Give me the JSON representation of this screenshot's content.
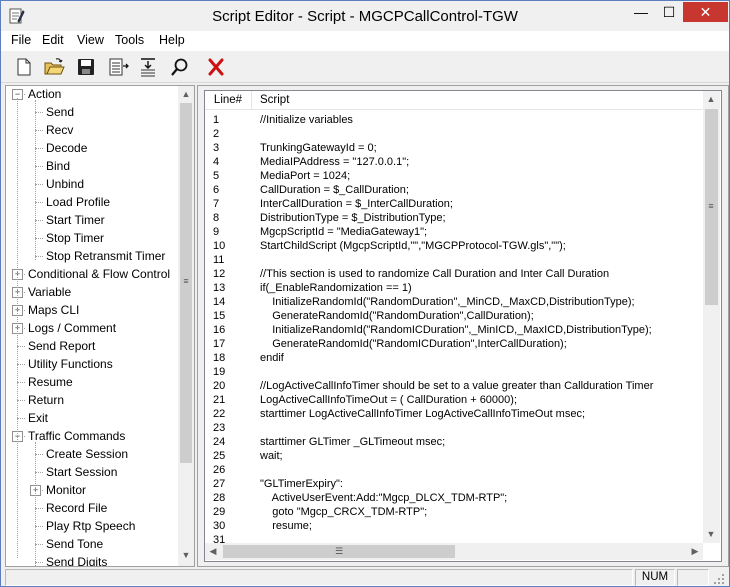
{
  "window": {
    "title": "Script Editor - Script - MGCPCallControl-TGW",
    "minimize": "—",
    "maximize": "☐",
    "close": "✕"
  },
  "menu": [
    "File",
    "Edit",
    "View",
    "Tools",
    "Help"
  ],
  "toolbar": {
    "icons": [
      "new-document-icon",
      "open-folder-icon",
      "save-icon",
      "insert-icon",
      "format-icon",
      "find-icon",
      "delete-icon"
    ]
  },
  "tree": {
    "items": [
      {
        "label": "Action",
        "expander": "-"
      },
      {
        "label": "Send"
      },
      {
        "label": "Recv"
      },
      {
        "label": "Decode"
      },
      {
        "label": "Bind"
      },
      {
        "label": "Unbind"
      },
      {
        "label": "Load Profile"
      },
      {
        "label": "Start Timer"
      },
      {
        "label": "Stop Timer"
      },
      {
        "label": "Stop Retransmit Timer"
      },
      {
        "label": "Conditional & Flow Control",
        "expander": "+"
      },
      {
        "label": "Variable",
        "expander": "+"
      },
      {
        "label": "Maps CLI",
        "expander": "+"
      },
      {
        "label": "Logs / Comment",
        "expander": "+"
      },
      {
        "label": "Send Report"
      },
      {
        "label": "Utility Functions"
      },
      {
        "label": "Resume"
      },
      {
        "label": "Return"
      },
      {
        "label": "Exit"
      },
      {
        "label": "Traffic Commands",
        "expander": "-"
      },
      {
        "label": "Create Session"
      },
      {
        "label": "Start Session"
      },
      {
        "label": "Monitor",
        "expander": "+"
      },
      {
        "label": "Record File"
      },
      {
        "label": "Play Rtp Speech"
      },
      {
        "label": "Send Tone"
      },
      {
        "label": "Send Digits"
      }
    ]
  },
  "script": {
    "header_line": "Line#",
    "header_script": "Script",
    "lines": [
      {
        "n": "1",
        "code": "//Initialize variables"
      },
      {
        "n": "2",
        "code": ""
      },
      {
        "n": "3",
        "code": "TrunkingGatewayId = 0;"
      },
      {
        "n": "4",
        "code": "MediaIPAddress = \"127.0.0.1\";"
      },
      {
        "n": "5",
        "code": "MediaPort = 1024;"
      },
      {
        "n": "6",
        "code": "CallDuration = $_CallDuration;"
      },
      {
        "n": "7",
        "code": "InterCallDuration = $_InterCallDuration;"
      },
      {
        "n": "8",
        "code": "DistributionType = $_DistributionType;"
      },
      {
        "n": "9",
        "code": "MgcpScriptId = \"MediaGateway1\";"
      },
      {
        "n": "10",
        "code": "StartChildScript (MgcpScriptId,\"\",\"MGCPProtocol-TGW.gls\",\"\");"
      },
      {
        "n": "11",
        "code": ""
      },
      {
        "n": "12",
        "code": "//This section is used to randomize Call Duration and Inter Call Duration"
      },
      {
        "n": "13",
        "code": "if(_EnableRandomization == 1)"
      },
      {
        "n": "14",
        "code": "    InitializeRandomId(\"RandomDuration\",_MinCD,_MaxCD,DistributionType);"
      },
      {
        "n": "15",
        "code": "    GenerateRandomId(\"RandomDuration\",CallDuration);"
      },
      {
        "n": "16",
        "code": "    InitializeRandomId(\"RandomICDuration\",_MinICD,_MaxICD,DistributionType);"
      },
      {
        "n": "17",
        "code": "    GenerateRandomId(\"RandomICDuration\",InterCallDuration);"
      },
      {
        "n": "18",
        "code": "endif"
      },
      {
        "n": "19",
        "code": ""
      },
      {
        "n": "20",
        "code": "//LogActiveCallInfoTimer should be set to a value greater than Callduration Timer"
      },
      {
        "n": "21",
        "code": "LogActiveCallInfoTimeOut = ( CallDuration + 60000);"
      },
      {
        "n": "22",
        "code": "starttimer LogActiveCallInfoTimer LogActiveCallInfoTimeOut msec;"
      },
      {
        "n": "23",
        "code": ""
      },
      {
        "n": "24",
        "code": "starttimer GLTimer _GLTimeout msec;"
      },
      {
        "n": "25",
        "code": "wait;"
      },
      {
        "n": "26",
        "code": ""
      },
      {
        "n": "27",
        "code": "\"GLTimerExpiry\":"
      },
      {
        "n": "28",
        "code": "    ActiveUserEvent:Add:\"Mgcp_DLCX_TDM-RTP\";"
      },
      {
        "n": "29",
        "code": "    goto \"Mgcp_CRCX_TDM-RTP\";"
      },
      {
        "n": "30",
        "code": "    resume;"
      },
      {
        "n": "31",
        "code": ""
      }
    ]
  },
  "status": {
    "num": "NUM"
  },
  "colors": {
    "close_button": "#c7372f",
    "delete_icon": "#cc1111"
  }
}
